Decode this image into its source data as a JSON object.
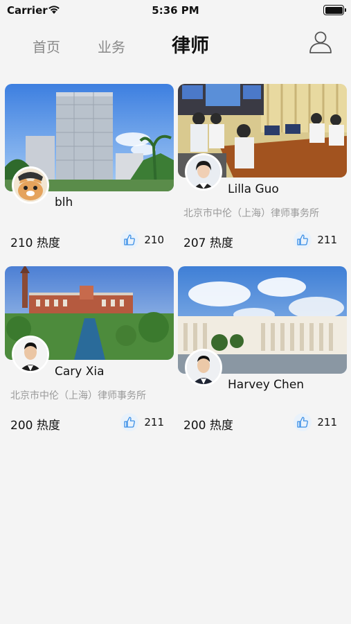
{
  "status_bar": {
    "carrier": "Carrier",
    "time": "5:36 PM"
  },
  "nav": {
    "tabs": [
      {
        "label": "首页"
      },
      {
        "label": "业务"
      },
      {
        "label": "律师"
      }
    ]
  },
  "lawyers": [
    {
      "name": "blh",
      "firm": "",
      "heat": "210 热度",
      "likes": "210"
    },
    {
      "name": "Lilla Guo",
      "firm": "北京市中伦（上海）律师事务所",
      "heat": "207 热度",
      "likes": "211"
    },
    {
      "name": "Cary Xia",
      "firm": "北京市中伦（上海）律师事务所",
      "heat": "200 热度",
      "likes": "211"
    },
    {
      "name": "Harvey Chen",
      "firm": "",
      "heat": "200 热度",
      "likes": "211"
    }
  ]
}
